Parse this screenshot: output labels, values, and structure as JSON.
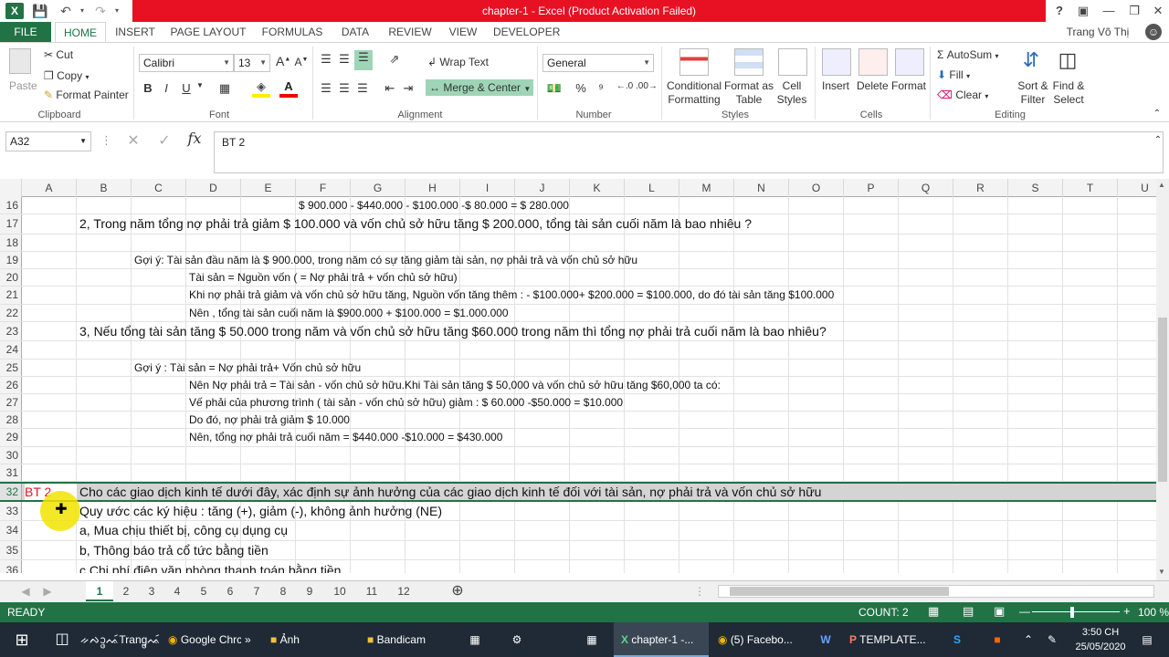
{
  "window": {
    "title": "chapter-1 -  Excel (Product Activation Failed)",
    "user": "Trang Võ Thị"
  },
  "tabs": [
    "FILE",
    "HOME",
    "INSERT",
    "PAGE LAYOUT",
    "FORMULAS",
    "DATA",
    "REVIEW",
    "VIEW",
    "DEVELOPER"
  ],
  "ribbon": {
    "paste": "Paste",
    "cut": "Cut",
    "copy": "Copy",
    "format_painter": "Format Painter",
    "font_name": "Calibri",
    "font_size": "13",
    "bold": "B",
    "italic": "I",
    "underline": "U",
    "wrap_text": "Wrap Text",
    "merge_center": "Merge & Center",
    "number_format": "General",
    "percent": "%",
    "comma": "⁹",
    "conditional_formatting": "Conditional Formatting",
    "format_as_table": "Format as Table",
    "cell_styles": "Cell Styles",
    "insert": "Insert",
    "delete": "Delete",
    "format": "Format",
    "autosum": "AutoSum",
    "fill": "Fill",
    "clear": "Clear",
    "sort_filter": "Sort & Filter",
    "find_select": "Find & Select",
    "groups": {
      "clipboard": "Clipboard",
      "font": "Font",
      "alignment": "Alignment",
      "number": "Number",
      "styles": "Styles",
      "cells": "Cells",
      "editing": "Editing"
    }
  },
  "formula_bar": {
    "name_box": "A32",
    "content": "BT 2"
  },
  "columns": [
    "A",
    "B",
    "C",
    "D",
    "E",
    "F",
    "G",
    "H",
    "I",
    "J",
    "K",
    "L",
    "M",
    "N",
    "O",
    "P",
    "Q",
    "R",
    "S",
    "T",
    "U"
  ],
  "rows": [
    {
      "n": "16",
      "cells": [
        {
          "col": "F",
          "text": "$ 900.000 - $440.000 - $100.000 -$ 80.000 = $ 280.000",
          "size": "s"
        }
      ]
    },
    {
      "n": "17",
      "cells": [
        {
          "col": "B",
          "text": "2, Trong năm tổng nợ phải trả giảm $ 100.000 và vốn chủ sở hữu tăng $ 200.000, tổng tài sản cuối năm là bao nhiêu ?",
          "size": "l"
        }
      ]
    },
    {
      "n": "18",
      "cells": []
    },
    {
      "n": "19",
      "cells": [
        {
          "col": "C",
          "text": "Gợi ý: Tài sản đầu năm là $ 900.000, trong năm có sự tăng giảm tài sản, nợ phải trả và vốn chủ sở hữu",
          "size": "s"
        }
      ]
    },
    {
      "n": "20",
      "cells": [
        {
          "col": "D",
          "text": "Tài sản = Nguồn vốn ( = Nợ phải trả + vốn chủ sở hữu)",
          "size": "s"
        }
      ]
    },
    {
      "n": "21",
      "cells": [
        {
          "col": "D",
          "text": "Khi nợ phải trả giảm và vốn chủ sở hữu tăng, Nguồn vốn tăng thêm : - $100.000+ $200.000 = $100.000, do đó tài sản tăng $100.000",
          "size": "s"
        }
      ]
    },
    {
      "n": "22",
      "cells": [
        {
          "col": "D",
          "text": " Nên , tổng tài sản cuối năm là $900.000 + $100.000 = $1.000.000",
          "size": "s"
        }
      ]
    },
    {
      "n": "23",
      "cells": [
        {
          "col": "B",
          "text": "3, Nếu tổng tài sản tăng $ 50.000 trong năm và vốn chủ sở hữu tăng $60.000 trong năm thì tổng nợ phải trả cuối năm là bao nhiêu?",
          "size": "l"
        }
      ]
    },
    {
      "n": "24",
      "cells": []
    },
    {
      "n": "25",
      "cells": [
        {
          "col": "C",
          "text": "Gợi ý : Tài sản = Nợ phải trả+ Vốn chủ sở hữu",
          "size": "s"
        }
      ]
    },
    {
      "n": "26",
      "cells": [
        {
          "col": "D",
          "text": "Nên  Nợ phải trả = Tài sản - vốn chủ sở hữu.Khi Tài sản tăng $ 50,000 và vốn chủ sở hữu tăng $60,000 ta có:",
          "size": "s"
        }
      ]
    },
    {
      "n": "27",
      "cells": [
        {
          "col": "D",
          "text": "Vế phải của phương trình ( tài sản - vốn chủ sở hữu) giảm : $ 60.000 -$50.000 = $10.000",
          "size": "s"
        }
      ]
    },
    {
      "n": "28",
      "cells": [
        {
          "col": "D",
          "text": "Do đó, nợ phải trả giảm $ 10.000",
          "size": "s"
        }
      ]
    },
    {
      "n": "29",
      "cells": [
        {
          "col": "D",
          "text": "Nên, tổng nợ phải trả cuối năm = $440.000 -$10.000 = $430.000",
          "size": "s"
        }
      ]
    },
    {
      "n": "30",
      "cells": []
    },
    {
      "n": "31",
      "cells": []
    },
    {
      "n": "32",
      "cells": [
        {
          "col": "A",
          "text": "BT 2",
          "size": "l",
          "red": true
        },
        {
          "col": "B",
          "text": "Cho các giao dịch kinh tế dưới đây, xác định sự ảnh hưởng của các giao dịch kinh tế đối với tài sản, nợ phải trả và vốn chủ sở hữu",
          "size": "l"
        }
      ],
      "selected": true
    },
    {
      "n": "33",
      "cells": [
        {
          "col": "B",
          "text": "Quy ước các ký hiệu : tăng (+), giảm (-), không ảnh hưởng (NE)",
          "size": "l"
        }
      ]
    },
    {
      "n": "34",
      "cells": [
        {
          "col": "B",
          "text": "a, Mua chịu thiết bị, công cụ dụng cụ",
          "size": "l"
        }
      ]
    },
    {
      "n": "35",
      "cells": [
        {
          "col": "B",
          "text": "b, Thông báo trả cổ tức bằng tiền",
          "size": "l"
        }
      ]
    },
    {
      "n": "36",
      "cells": [
        {
          "col": "B",
          "text": "c,Chi phí điện văn phòng thanh toán bằng tiền",
          "size": "l"
        }
      ]
    }
  ],
  "sheets": [
    "1",
    "2",
    "3",
    "4",
    "5",
    "6",
    "7",
    "8",
    "9",
    "10",
    "11",
    "12"
  ],
  "active_sheet": "1",
  "status": {
    "mode": "READY",
    "count": "COUNT: 2",
    "zoom": "100 %"
  },
  "taskbar": {
    "items": [
      "ᨀᨄᩣ᩠ᨴᨕᩢTrang᩠ᨴᨕᩢ",
      "Google Chrc",
      "Ảnh",
      "Bandicam",
      "chapter-1 -...",
      "(5) Facebo...",
      "TEMPLATE..."
    ],
    "time": "3:50 CH",
    "date": "25/05/2020"
  },
  "colors": {
    "excel_green": "#217346",
    "title_red": "#e81123",
    "selection_gray": "#d4d4d4"
  }
}
